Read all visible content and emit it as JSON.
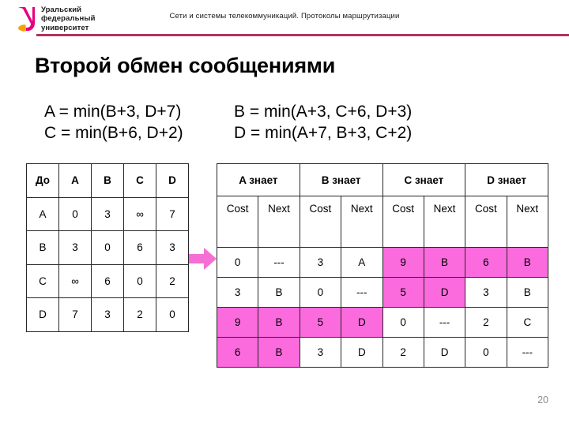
{
  "header": {
    "subtitle": "Сети и системы телекоммуникаций. Протоколы маршрутизации",
    "rule_color": "#b5305f",
    "logo": {
      "line1": "Уральский",
      "line2": "федеральный",
      "line3": "университет",
      "mark_colors": [
        "#e6007e",
        "#f5a300"
      ]
    }
  },
  "title": "Второй обмен сообщениями",
  "formulas": {
    "a": "A = min(B+3, D+7)",
    "b": "B = min(A+3, C+6, D+3)",
    "c": "C = min(B+6, D+2)",
    "d": "D = min(A+7, B+3, C+2)"
  },
  "table_left": {
    "headers": [
      "До",
      "A",
      "B",
      "C",
      "D"
    ],
    "rows": [
      [
        "A",
        "0",
        "3",
        "∞",
        "7"
      ],
      [
        "B",
        "3",
        "0",
        "6",
        "3"
      ],
      [
        "C",
        "∞",
        "6",
        "0",
        "2"
      ],
      [
        "D",
        "7",
        "3",
        "2",
        "0"
      ]
    ]
  },
  "table_right": {
    "group_headers": [
      "A знает",
      "B знает",
      "C знает",
      "D знает"
    ],
    "sub_headers": [
      "Cost",
      "Next",
      "Cost",
      "Next",
      "Cost",
      "Next",
      "Cost",
      "Next"
    ],
    "highlight_color": "#fb6bdd",
    "rows": [
      {
        "cells": [
          "0",
          "---",
          "3",
          "A",
          "9",
          "B",
          "6",
          "B"
        ],
        "highlight": [
          false,
          false,
          false,
          false,
          true,
          true,
          true,
          true
        ]
      },
      {
        "cells": [
          "3",
          "B",
          "0",
          "---",
          "5",
          "D",
          "3",
          "B"
        ],
        "highlight": [
          false,
          false,
          false,
          false,
          true,
          true,
          false,
          false
        ]
      },
      {
        "cells": [
          "9",
          "B",
          "5",
          "D",
          "0",
          "---",
          "2",
          "C"
        ],
        "highlight": [
          true,
          true,
          true,
          true,
          false,
          false,
          false,
          false
        ]
      },
      {
        "cells": [
          "6",
          "B",
          "3",
          "D",
          "2",
          "D",
          "0",
          "---"
        ],
        "highlight": [
          true,
          true,
          false,
          false,
          false,
          false,
          false,
          false
        ]
      }
    ]
  },
  "arrow": {
    "name": "right-arrow",
    "color": "#f56fd4"
  },
  "slide_number": "20"
}
